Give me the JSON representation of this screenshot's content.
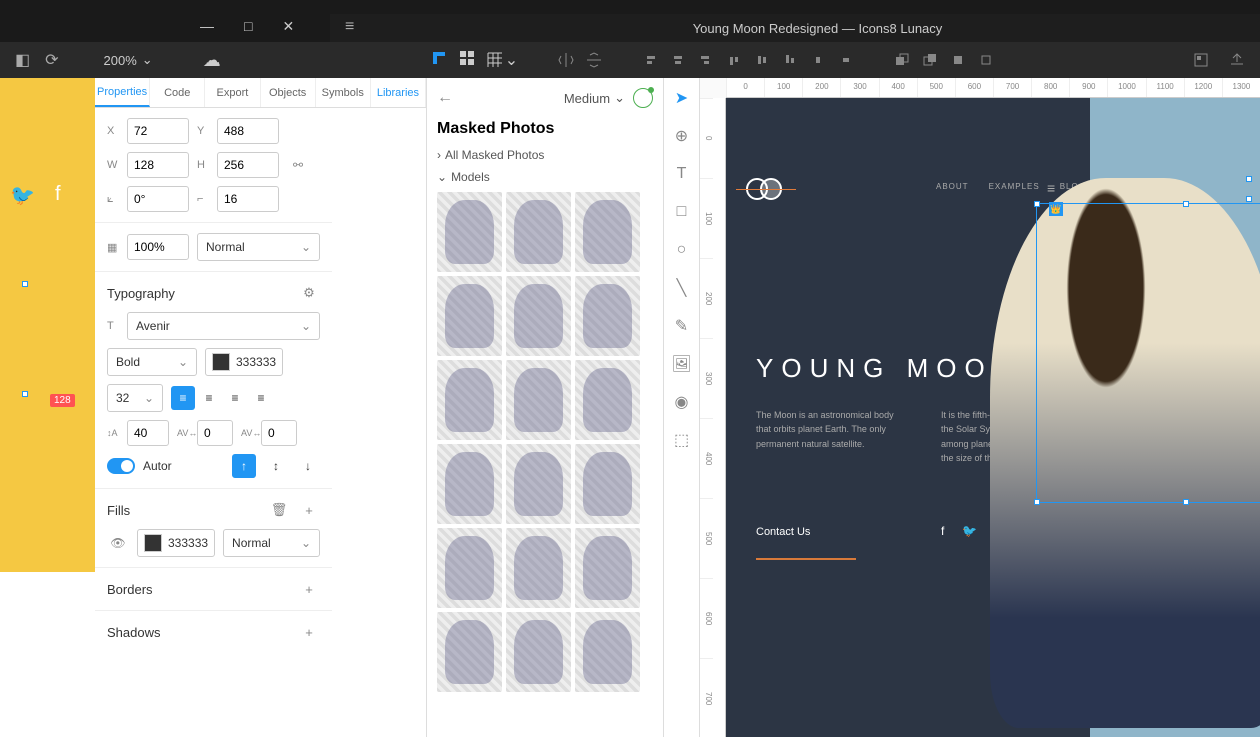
{
  "window": {
    "title": "Young Moon Redesigned — Icons8 Lunacy"
  },
  "zoom": "200%",
  "tabs": {
    "properties": "Properties",
    "code": "Code",
    "export": "Export",
    "objects": "Objects",
    "symbols": "Symbols",
    "libraries": "Libraries"
  },
  "props": {
    "x_label": "X",
    "x": "72",
    "y_label": "Y",
    "y": "488",
    "w_label": "W",
    "w": "128",
    "h_label": "H",
    "h": "256",
    "rotation": "0°",
    "corner": "16",
    "opacity": "100%",
    "blend": "Normal",
    "typography_title": "Typography",
    "font_family": "Avenir",
    "font_weight": "Bold",
    "font_color": "333333",
    "font_size": "32",
    "line_height": "40",
    "letter_spacing": "0",
    "paragraph_spacing": "0",
    "auto_label": "Autor",
    "fills_title": "Fills",
    "fill_color": "333333",
    "fill_mode": "Normal",
    "borders_title": "Borders",
    "shadows_title": "Shadows"
  },
  "library": {
    "dropdown": "Medium",
    "title": "Masked Photos",
    "all_cat": "All Masked Photos",
    "models_cat": "Models"
  },
  "ruler_h": [
    "0",
    "100",
    "200",
    "300",
    "400",
    "500",
    "600",
    "700",
    "800",
    "900",
    "1000",
    "1100",
    "1200",
    "1300"
  ],
  "ruler_v": [
    "0",
    "100",
    "200",
    "300",
    "400",
    "500",
    "600",
    "700"
  ],
  "artboard": {
    "nav": {
      "about": "ABOUT",
      "examples": "EXAMPLES",
      "blog": "BLOG"
    },
    "hero": "YOUNG MOON",
    "amp": "&",
    "p1": "The Moon is an astronomical body that orbits planet Earth. The only permanent natural satellite.",
    "p2": "It is the fifth-largest natural satellite in the Solar System, and the largest among planetary satellites relative to the size of the planet that it orbits",
    "contact": "Contact Us"
  },
  "dim_label": "128"
}
